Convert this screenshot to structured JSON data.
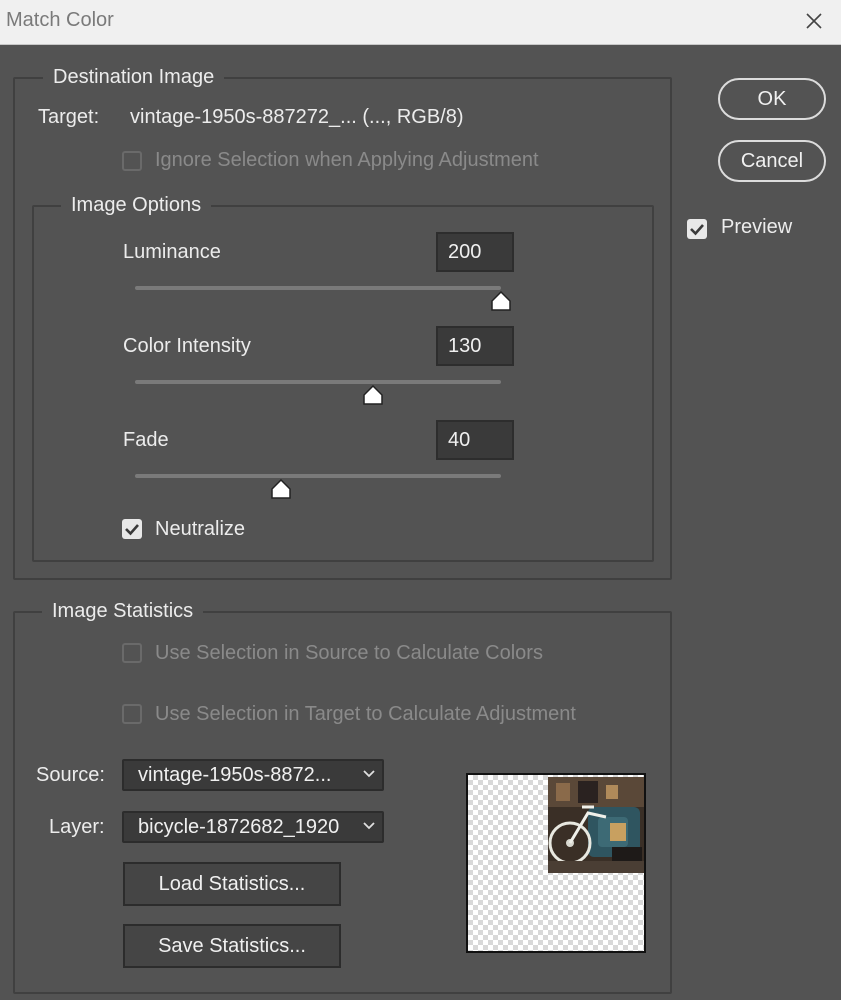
{
  "window": {
    "title": "Match Color"
  },
  "buttons": {
    "ok": "OK",
    "cancel": "Cancel"
  },
  "preview": {
    "label": "Preview",
    "checked": true
  },
  "destination": {
    "legend": "Destination Image",
    "target_label": "Target:",
    "target_value": "vintage-1950s-887272_... (..., RGB/8)",
    "ignore_selection": "Ignore Selection when Applying Adjustment"
  },
  "image_options": {
    "legend": "Image Options",
    "luminance": {
      "label": "Luminance",
      "value": "200",
      "fraction": 1.0
    },
    "color_intensity": {
      "label": "Color Intensity",
      "value": "130",
      "fraction": 0.65
    },
    "fade": {
      "label": "Fade",
      "value": "40",
      "fraction": 0.4
    },
    "neutralize": {
      "label": "Neutralize",
      "checked": true
    }
  },
  "statistics": {
    "legend": "Image Statistics",
    "use_source": "Use Selection in Source to Calculate Colors",
    "use_target": "Use Selection in Target to Calculate Adjustment",
    "source_label": "Source:",
    "source_value": "vintage-1950s-8872...",
    "layer_label": "Layer:",
    "layer_value": "bicycle-1872682_1920",
    "load_button": "Load Statistics...",
    "save_button": "Save Statistics..."
  },
  "colors": {
    "background": "#535353",
    "titlebar": "#f0f0f0",
    "field": "#3a3a3a"
  },
  "icons": {
    "close": "close-icon",
    "checkbox": "checkmark-icon",
    "slider_thumb": "slider-thumb-icon",
    "dropdown": "chevron-down-icon"
  }
}
